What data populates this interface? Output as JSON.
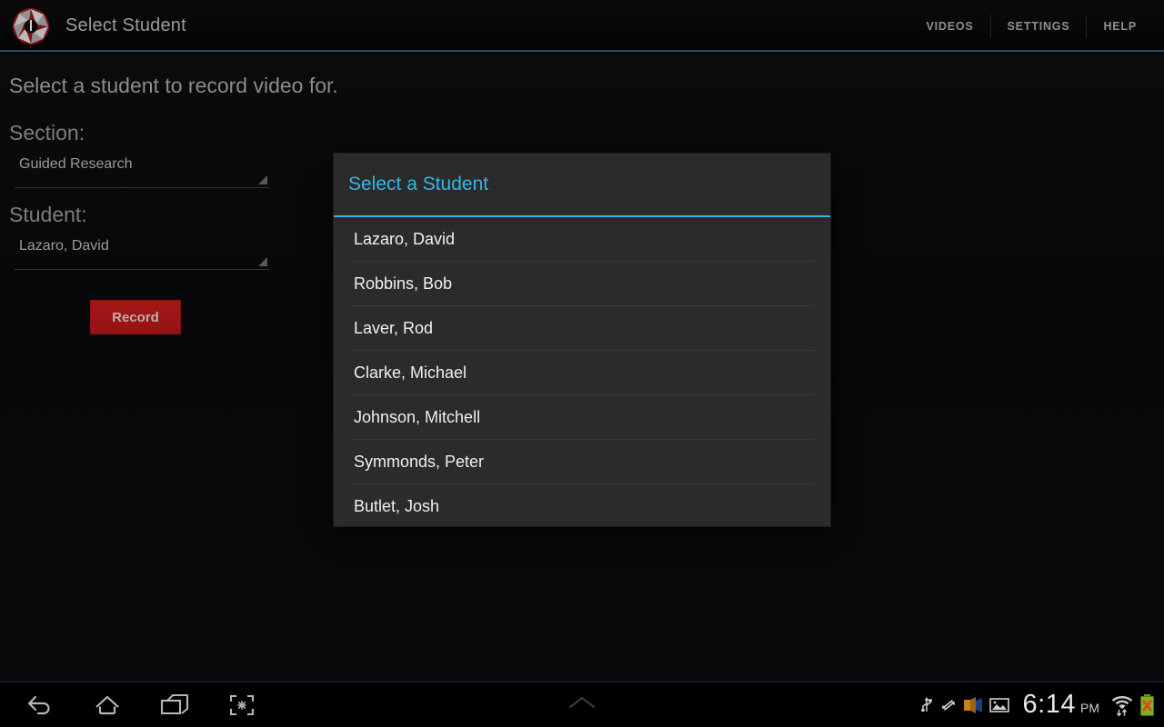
{
  "action_bar": {
    "logo_icon": "camera-aperture-icon",
    "title": "Select Student",
    "menu": [
      {
        "label": "VIDEOS"
      },
      {
        "label": "SETTINGS"
      },
      {
        "label": "HELP"
      }
    ]
  },
  "content": {
    "prompt": "Select a student to record video for.",
    "section": {
      "label": "Section:",
      "value": "Guided Research",
      "dropdown_icon": "spinner-triangle-icon"
    },
    "student": {
      "label": "Student:",
      "value": "Lazaro,  David",
      "dropdown_icon": "spinner-triangle-icon"
    },
    "record_button": {
      "label": "Record"
    }
  },
  "dialog": {
    "title": "Select a Student",
    "students": [
      {
        "name": "Lazaro,  David"
      },
      {
        "name": "Robbins,  Bob"
      },
      {
        "name": "Laver,  Rod"
      },
      {
        "name": "Clarke,  Michael"
      },
      {
        "name": "Johnson,  Mitchell"
      },
      {
        "name": "Symmonds,  Peter"
      },
      {
        "name": "Butlet,  Josh"
      }
    ]
  },
  "nav_bar": {
    "buttons": [
      {
        "icon": "back-icon"
      },
      {
        "icon": "home-icon"
      },
      {
        "icon": "recent-apps-icon"
      },
      {
        "icon": "screenshot-icon"
      }
    ],
    "center_icon": "chevron-up-icon",
    "status_icons": [
      {
        "icon": "usb-icon"
      },
      {
        "icon": "sync-arrows-icon"
      },
      {
        "icon": "projector-icon"
      },
      {
        "icon": "gallery-image-icon"
      }
    ],
    "clock": {
      "time": "6:14",
      "period": "PM"
    },
    "right_icons": [
      {
        "icon": "wifi-signal-icon"
      },
      {
        "icon": "battery-error-icon"
      }
    ]
  },
  "colors": {
    "accent_blue": "#33b5e5",
    "record_red": "#a41717",
    "dialog_bg": "#2b2b2b",
    "page_bg": "#0a0a0c"
  }
}
